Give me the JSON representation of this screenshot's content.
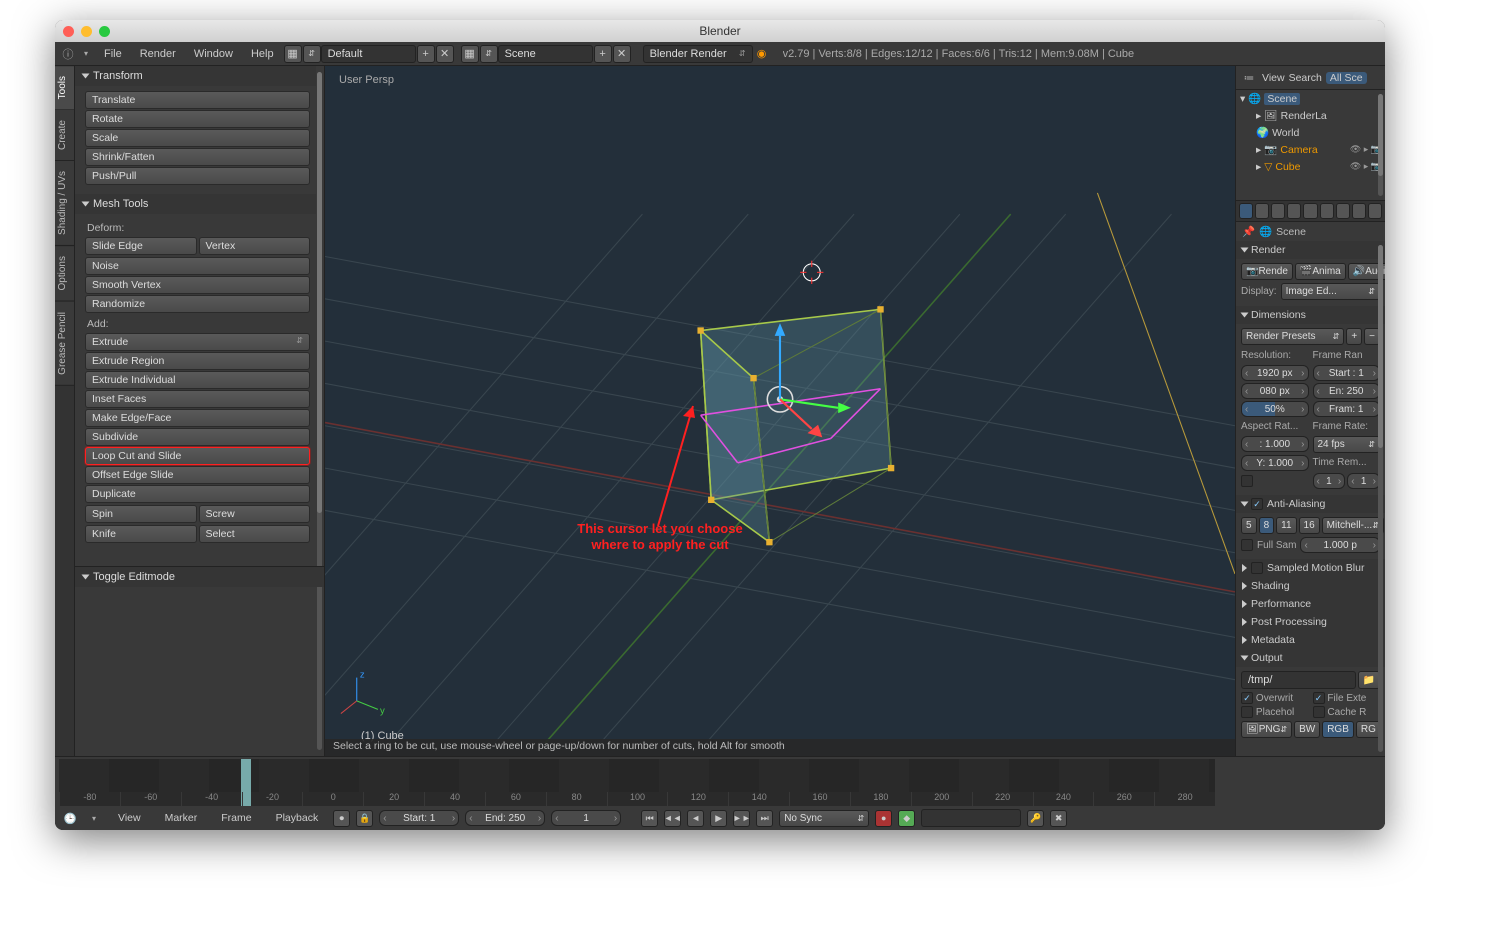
{
  "titlebar": {
    "title": "Blender"
  },
  "topmenu": {
    "items": [
      "File",
      "Render",
      "Window",
      "Help"
    ],
    "layout_label": "Default",
    "scene_label": "Scene",
    "engine_label": "Blender Render",
    "stats": "v2.79 | Verts:8/8 | Edges:12/12 | Faces:6/6 | Tris:12 | Mem:9.08M | Cube"
  },
  "side_tabs": [
    "Tools",
    "Create",
    "Shading / UVs",
    "Options",
    "Grease Pencil"
  ],
  "tool_panels": {
    "transform": {
      "title": "Transform",
      "buttons": [
        "Translate",
        "Rotate",
        "Scale",
        "Shrink/Fatten",
        "Push/Pull"
      ]
    },
    "mesh_tools": {
      "title": "Mesh Tools",
      "deform_label": "Deform:",
      "deform_row": [
        "Slide Edge",
        "Vertex"
      ],
      "deform_buttons": [
        "Noise",
        "Smooth Vertex",
        "Randomize"
      ],
      "add_label": "Add:",
      "add_dropdown": "Extrude",
      "add_buttons": [
        "Extrude Region",
        "Extrude Individual",
        "Inset Faces",
        "Make Edge/Face",
        "Subdivide",
        "Loop Cut and Slide",
        "Offset Edge Slide",
        "Duplicate"
      ],
      "spin_row": [
        "Spin",
        "Screw"
      ],
      "knife_row": [
        "Knife",
        "Select"
      ]
    },
    "operator": {
      "title": "Toggle Editmode"
    }
  },
  "viewport": {
    "persp_label": "User Persp",
    "object_label": "(1) Cube",
    "status_hint": "Select a ring to be cut, use mouse-wheel or page-up/down for number of cuts, hold Alt for smooth",
    "annotation_line1": "This cursor let you choose",
    "annotation_line2": "where to apply the cut"
  },
  "outliner": {
    "view_label": "View",
    "search_label": "Search",
    "filter_label": "All Sce",
    "tree": {
      "scene": "Scene",
      "renderlayers": "RenderLa",
      "world": "World",
      "camera": "Camera",
      "cube": "Cube"
    }
  },
  "breadcrumb": {
    "scene": "Scene"
  },
  "render_panel": {
    "title": "Render",
    "btn_render": "Rende",
    "btn_anim": "Anima",
    "btn_audio": "Audio",
    "display_label": "Display:",
    "display_value": "Image Ed..."
  },
  "dimensions_panel": {
    "title": "Dimensions",
    "presets_label": "Render Presets",
    "res_label": "Resolution:",
    "frame_range_label": "Frame Ran",
    "res_x": "1920 px",
    "res_y": "080 px",
    "res_pct": "50%",
    "start": "Start : 1",
    "end": "En: 250",
    "frame_step": "Fram: 1",
    "aspect_label": "Aspect Rat...",
    "framerate_label": "Frame Rate:",
    "aspect_x": ": 1.000",
    "aspect_y": "Y: 1.000",
    "fps": "24 fps",
    "time_remap": "Time Rem...",
    "old": "1",
    "new": "1"
  },
  "aa_panel": {
    "title": "Anti-Aliasing",
    "samples": [
      "5",
      "8",
      "11",
      "16"
    ],
    "filter": "Mitchell-...",
    "full_sample": "Full Sam",
    "pixel_size": "1.000 p"
  },
  "collapsed_panels": {
    "motion_blur": "Sampled Motion Blur",
    "shading": "Shading",
    "performance": "Performance",
    "post": "Post Processing",
    "metadata": "Metadata",
    "output": "Output"
  },
  "output_panel": {
    "path": "/tmp/",
    "overwrite": "Overwrit",
    "file_ext": "File Exte",
    "placeholder": "Placehol",
    "cache": "Cache R",
    "format": "PNG",
    "bw": "BW",
    "rgb": "RGB",
    "rgba": "RG"
  },
  "timeline": {
    "view": "View",
    "marker": "Marker",
    "frame": "Frame",
    "playback": "Playback",
    "start_label": "Start:",
    "start_val": "1",
    "end_label": "End:",
    "end_val": "250",
    "cur_val": "1",
    "sync": "No Sync",
    "ticks": [
      "-80",
      "-60",
      "-40",
      "-20",
      "0",
      "20",
      "40",
      "60",
      "80",
      "100",
      "120",
      "140",
      "160",
      "180",
      "200",
      "220",
      "240",
      "260",
      "280"
    ]
  }
}
